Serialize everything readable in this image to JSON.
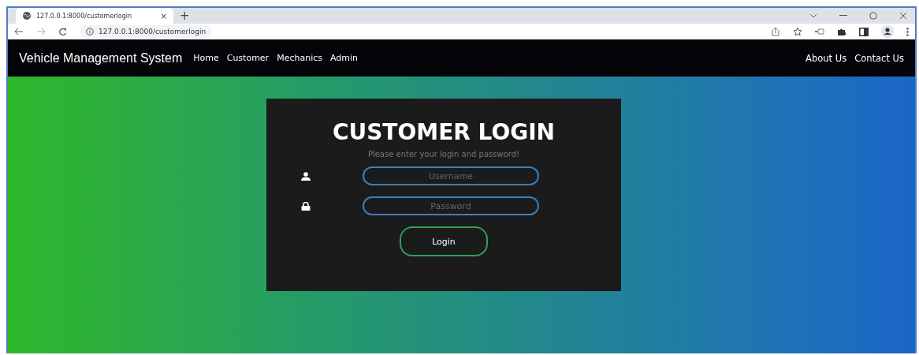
{
  "browser": {
    "tab_title": "127.0.0.1:8000/customerlogin",
    "new_tab": "+",
    "close_tab": "×",
    "address": "127.0.0.1:8000/customerlogin"
  },
  "navbar": {
    "brand": "Vehicle Management System",
    "links": [
      "Home",
      "Customer",
      "Mechanics",
      "Admin"
    ],
    "right_links": [
      "About Us",
      "Contact Us"
    ]
  },
  "login": {
    "title": "CUSTOMER LOGIN",
    "subtitle": "Please enter your login and password!",
    "fields": [
      {
        "kind": "user",
        "placeholder": "Username"
      },
      {
        "kind": "lock",
        "placeholder": "Password"
      }
    ],
    "button": "Login"
  }
}
